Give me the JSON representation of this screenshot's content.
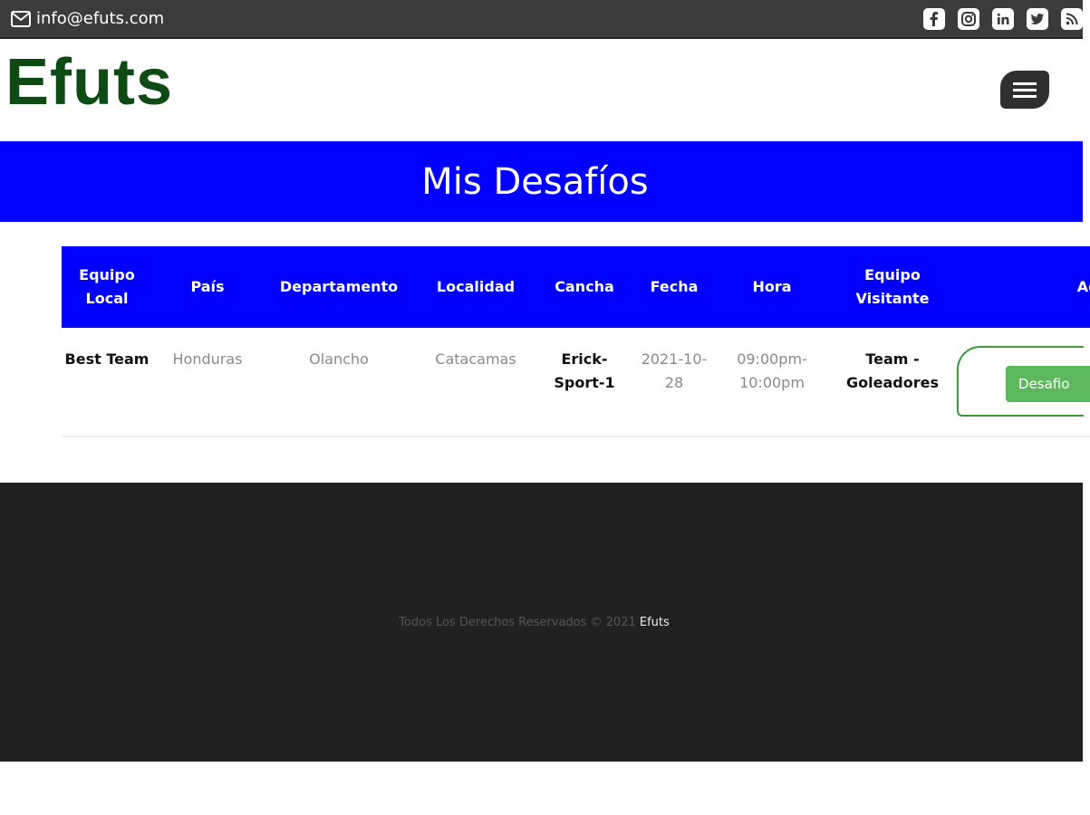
{
  "topbar": {
    "email": "info@efuts.com",
    "socials": [
      {
        "icon": "facebook-icon"
      },
      {
        "icon": "instagram-icon"
      },
      {
        "icon": "linkedin-icon"
      },
      {
        "icon": "twitter-icon"
      },
      {
        "icon": "rss-icon"
      }
    ]
  },
  "header": {
    "logo": "Efuts",
    "logo_color": "#0d4a14",
    "menu_icon": "hamburger-menu-icon"
  },
  "title_band": {
    "title": "Mis Desafíos",
    "color": "#0000ff"
  },
  "table": {
    "headers": {
      "equipo_local": "Equipo Local",
      "pais": "País",
      "departamento": "Departamento",
      "localidad": "Localidad",
      "cancha": "Cancha",
      "fecha": "Fecha",
      "hora": "Hora",
      "equipo_visitante": "Equipo Visitante",
      "accion": "Acción"
    },
    "rows": [
      {
        "equipo_local": "Best Team",
        "pais": "Honduras",
        "departamento": "Olancho",
        "localidad": "Catacamas",
        "cancha": "Erick-Sport-1",
        "fecha": "2021-10-28",
        "hora": "09:00pm-10:00pm",
        "equipo_visitante": "Team - Goleadores",
        "accion_label": "Desafio"
      }
    ]
  },
  "footer": {
    "text": "Todos Los Derechos Reservados © 2021",
    "brand": "Efuts"
  }
}
